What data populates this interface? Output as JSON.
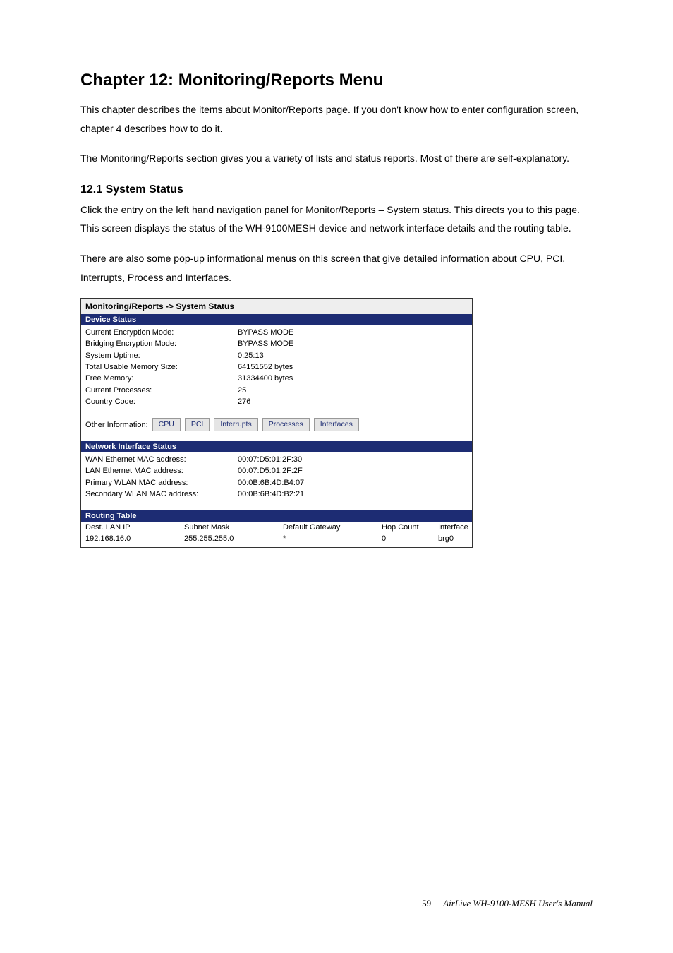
{
  "chapter_title": "Chapter 12: Monitoring/Reports Menu",
  "para1": "This chapter describes the items about Monitor/Reports page. If you don't know how to enter configuration screen, chapter 4 describes how to do it.",
  "para2": "The Monitoring/Reports section gives you a variety of lists and status reports. Most of there are self-explanatory.",
  "section1_title": "12.1 System Status",
  "para3": "Click the entry on the left hand navigation panel for Monitor/Reports – System status. This directs you to this page. This screen displays the status of the WH-9100MESH device and network interface details and the routing table.",
  "para4": "There are also some pop-up informational menus on this screen that give detailed information about CPU, PCI, Interrupts, Process and Interfaces.",
  "panel": {
    "breadcrumb": "Monitoring/Reports -> System Status",
    "device_status_band": "Device Status",
    "device_status": [
      {
        "k": "Current Encryption Mode:",
        "v": "BYPASS MODE"
      },
      {
        "k": "Bridging Encryption Mode:",
        "v": "BYPASS MODE"
      },
      {
        "k": "System Uptime:",
        "v": "0:25:13"
      },
      {
        "k": "Total Usable Memory Size:",
        "v": "64151552 bytes"
      },
      {
        "k": "Free Memory:",
        "v": "31334400 bytes"
      },
      {
        "k": "Current Processes:",
        "v": "25"
      },
      {
        "k": "Country Code:",
        "v": "276"
      }
    ],
    "other_label": "Other Information:",
    "other_buttons": [
      "CPU",
      "PCI",
      "Interrupts",
      "Processes",
      "Interfaces"
    ],
    "nis_band": "Network Interface Status",
    "nis": [
      {
        "k": "WAN Ethernet MAC address:",
        "v": "00:07:D5:01:2F:30"
      },
      {
        "k": "LAN Ethernet MAC address:",
        "v": "00:07:D5:01:2F:2F"
      },
      {
        "k": "Primary WLAN MAC address:",
        "v": "00:0B:6B:4D:B4:07"
      },
      {
        "k": "Secondary WLAN MAC address:",
        "v": "00:0B:6B:4D:B2:21"
      }
    ],
    "routing_band": "Routing Table",
    "routing_head": [
      "Dest. LAN IP",
      "Subnet Mask",
      "Default Gateway",
      "Hop Count",
      "Interface"
    ],
    "routing_row": [
      "192.168.16.0",
      "255.255.255.0",
      "*",
      "0",
      "brg0"
    ]
  },
  "footer": {
    "page": "59",
    "doc": "AirLive WH-9100-MESH User's Manual"
  }
}
